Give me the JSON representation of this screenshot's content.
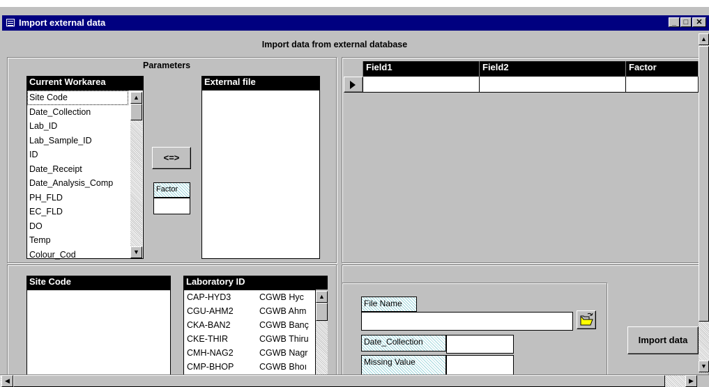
{
  "window": {
    "title": "Import external data"
  },
  "form": {
    "heading": "Import data from external database"
  },
  "parameters": {
    "group_label": "Parameters",
    "current_workarea": {
      "header": "Current Workarea",
      "items": [
        "Site Code",
        "Date_Collection",
        "Lab_ID",
        "Lab_Sample_ID",
        "ID",
        "Date_Receipt",
        "Date_Analysis_Comp",
        "PH_FLD",
        "EC_FLD",
        "DO",
        "Temp",
        "Colour_Cod"
      ]
    },
    "external_file": {
      "header": "External file"
    },
    "swap_button": "<=>",
    "factor_label": "Factor"
  },
  "grid": {
    "columns": [
      "Field1",
      "Field2",
      "Factor"
    ]
  },
  "site_code": {
    "header": "Site Code"
  },
  "laboratory": {
    "header": "Laboratory ID",
    "rows": [
      {
        "id": "CAP-HYD3",
        "name": "CGWB  Hyc"
      },
      {
        "id": "CGU-AHM2",
        "name": "CGWB  Ahm"
      },
      {
        "id": "CKA-BAN2",
        "name": "CGWB  Banç"
      },
      {
        "id": "CKE-THIR",
        "name": "CGWB  Thiru"
      },
      {
        "id": "CMH-NAG2",
        "name": "CGWB  Nagr"
      },
      {
        "id": "CMP-BHOP",
        "name": "CGWB  Bhoı"
      }
    ]
  },
  "file": {
    "file_name_label": "File Name",
    "file_name_value": "",
    "date_label": "Date_Collection",
    "date_value": "",
    "missing_label": "Missing Value",
    "missing_value": ""
  },
  "import_button": "Import data",
  "icons": [
    "app-form-icon",
    "minimize-icon",
    "maximize-icon",
    "close-icon",
    "record-selector-icon",
    "open-folder-icon",
    "scroll-up-icon",
    "scroll-down-icon",
    "scroll-left-icon",
    "scroll-right-icon"
  ]
}
